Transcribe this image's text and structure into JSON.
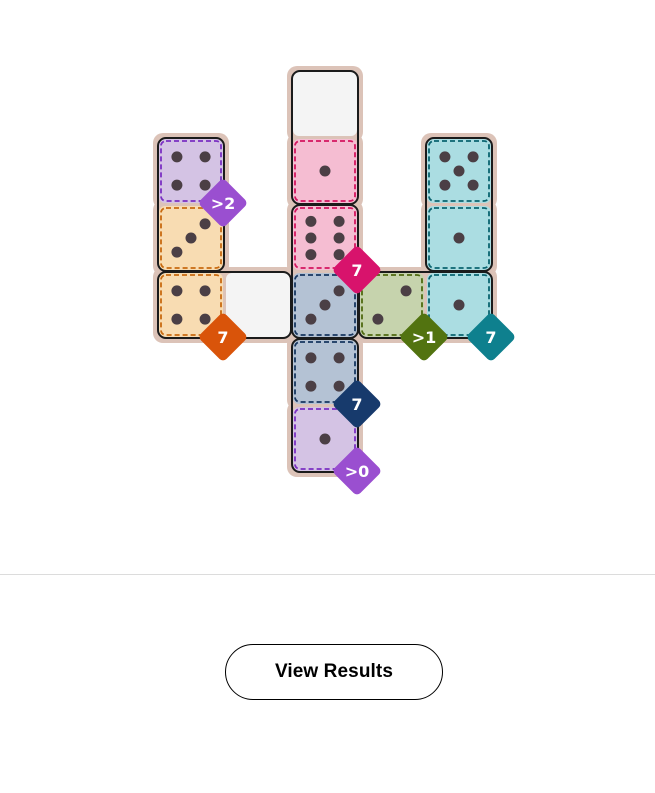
{
  "board": {
    "region_colors": {
      "purple": {
        "fill": "#d4c3e4",
        "border": "#7a2fc2",
        "badge": "#9a4fd0"
      },
      "orange": {
        "fill": "#f8dcb2",
        "border": "#c86a10",
        "badge": "#d9540a"
      },
      "pink": {
        "fill": "#f5bdd2",
        "border": "#d4145f",
        "badge": "#d8136c"
      },
      "navy": {
        "fill": "#b4c2d4",
        "border": "#17365f",
        "badge": "#173a6c"
      },
      "green": {
        "fill": "#c6d3ad",
        "border": "#4f6a10",
        "badge": "#527310"
      },
      "teal": {
        "fill": "#abdde2",
        "border": "#0b6470",
        "badge": "#0e808e"
      }
    },
    "colors": {
      "frame": "#dcc3b8",
      "pip": "#4b3f45",
      "empty_cell": "#f4f4f4",
      "domino_border": "#1b1b1b"
    },
    "cells": [
      {
        "col": 2,
        "row": 0,
        "region": null,
        "value": null
      },
      {
        "col": 0,
        "row": 1,
        "region": "purple",
        "value": 4
      },
      {
        "col": 2,
        "row": 1,
        "region": "pink",
        "value": 1
      },
      {
        "col": 4,
        "row": 1,
        "region": "teal",
        "value": 5
      },
      {
        "col": 0,
        "row": 2,
        "region": "orange",
        "value": 3
      },
      {
        "col": 2,
        "row": 2,
        "region": "pink",
        "value": 6
      },
      {
        "col": 4,
        "row": 2,
        "region": "teal",
        "value": 1
      },
      {
        "col": 0,
        "row": 3,
        "region": "orange",
        "value": 4
      },
      {
        "col": 1,
        "row": 3,
        "region": null,
        "value": null
      },
      {
        "col": 2,
        "row": 3,
        "region": "navy",
        "value": 3
      },
      {
        "col": 3,
        "row": 3,
        "region": "green",
        "value": 2
      },
      {
        "col": 4,
        "row": 3,
        "region": "teal",
        "value": 1
      },
      {
        "col": 2,
        "row": 4,
        "region": "navy",
        "value": 4
      },
      {
        "col": 2,
        "row": 5,
        "region": "purple",
        "value": 1
      }
    ],
    "dominoes": [
      {
        "cells": [
          [
            2,
            0
          ],
          [
            2,
            1
          ]
        ]
      },
      {
        "cells": [
          [
            0,
            1
          ],
          [
            0,
            2
          ]
        ]
      },
      {
        "cells": [
          [
            2,
            2
          ],
          [
            2,
            3
          ]
        ]
      },
      {
        "cells": [
          [
            4,
            1
          ],
          [
            4,
            2
          ]
        ]
      },
      {
        "cells": [
          [
            0,
            3
          ],
          [
            1,
            3
          ]
        ]
      },
      {
        "cells": [
          [
            3,
            3
          ],
          [
            4,
            3
          ]
        ]
      },
      {
        "cells": [
          [
            2,
            4
          ],
          [
            2,
            5
          ]
        ]
      }
    ],
    "constraints": [
      {
        "label": ">2",
        "region": "purple",
        "col": 0,
        "row": 1
      },
      {
        "label": "7",
        "region": "pink",
        "col": 2,
        "row": 2
      },
      {
        "label": "7",
        "region": "orange",
        "col": 0,
        "row": 3
      },
      {
        "label": ">1",
        "region": "green",
        "col": 3,
        "row": 3
      },
      {
        "label": "7",
        "region": "teal",
        "col": 4,
        "row": 3
      },
      {
        "label": "7",
        "region": "navy",
        "col": 2,
        "row": 4
      },
      {
        "label": ">0",
        "region": "purple",
        "col": 2,
        "row": 5
      }
    ]
  },
  "footer": {
    "results_button_label": "View Results"
  }
}
